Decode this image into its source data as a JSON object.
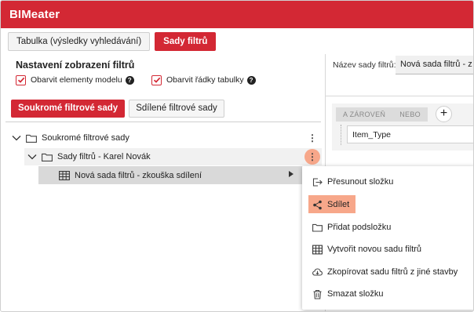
{
  "app": {
    "title": "BIMeater"
  },
  "tabs": [
    {
      "label": "Tabulka (výsledky vyhledávání)"
    },
    {
      "label": "Sady filtrů"
    }
  ],
  "filter_settings": {
    "title": "Nastavení zobrazení filtrů",
    "checkboxes": [
      {
        "label": "Obarvit elementy modelu",
        "checked": true
      },
      {
        "label": "Obarvit řádky tabulky",
        "checked": true
      }
    ],
    "help_glyph": "?"
  },
  "sub_tabs": [
    {
      "label": "Soukromé filtrové sady"
    },
    {
      "label": "Sdílené filtrové sady"
    }
  ],
  "tree": {
    "root": {
      "label": "Soukromé filtrové sady",
      "icon": "folder-icon"
    },
    "child": {
      "label": "Sady filtrů - Karel Novák",
      "icon": "folder-icon"
    },
    "leaf": {
      "label": "Nová sada filtrů - zkouška sdílení",
      "icon": "table-icon"
    },
    "kebab_glyph": "⋮"
  },
  "right_panel": {
    "name_label": "Název sady filtrů:",
    "name_value": "Nová sada filtrů - z",
    "logic_buttons": [
      "A ZÁROVEŇ",
      "NEBO"
    ],
    "add_glyph": "+",
    "field_value": "Item_Type"
  },
  "context_menu": {
    "items": [
      {
        "label": "Přesunout složku",
        "icon": "move-icon"
      },
      {
        "label": "Sdílet",
        "icon": "share-icon",
        "highlighted": true
      },
      {
        "label": "Přidat podsložku",
        "icon": "folder-icon"
      },
      {
        "label": "Vytvořit novou sadu filtrů",
        "icon": "table-icon"
      },
      {
        "label": "Zkopírovat sadu filtrů z jiné stavby",
        "icon": "cloud-download-icon"
      },
      {
        "label": "Smazat složku",
        "icon": "trash-icon"
      }
    ]
  },
  "colors": {
    "brand": "#d32834",
    "highlight": "#f7a78a",
    "selected_row": "#d9d9d9"
  }
}
